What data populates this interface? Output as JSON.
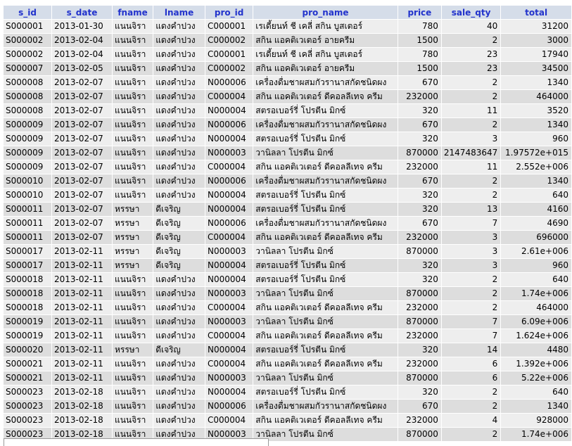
{
  "table": {
    "columns": [
      "s_id",
      "s_date",
      "fname",
      "lname",
      "pro_id",
      "pro_name",
      "price",
      "sale_qty",
      "total"
    ],
    "rows": [
      [
        "S000001",
        "2013-01-30",
        "แนนจิรา",
        "แดงคำปวง",
        "C000001",
        "เรเดี้ยนท์ ชี เคลี่ สกิน บูสเตอร์",
        "780",
        "40",
        "31200"
      ],
      [
        "S000002",
        "2013-02-04",
        "แนนจิรา",
        "แดงคำปวง",
        "C000002",
        "สกิน แอคติเวเตอร์ อายครีม",
        "1500",
        "2",
        "3000"
      ],
      [
        "S000002",
        "2013-02-04",
        "แนนจิรา",
        "แดงคำปวง",
        "C000001",
        "เรเดี้ยนท์ ชี เคลี่ สกิน บูสเตอร์",
        "780",
        "23",
        "17940"
      ],
      [
        "S000007",
        "2013-02-05",
        "แนนจิรา",
        "แดงคำปวง",
        "C000002",
        "สกิน แอคติเวเตอร์ อายครีม",
        "1500",
        "23",
        "34500"
      ],
      [
        "S000008",
        "2013-02-07",
        "แนนจิรา",
        "แดงคำปวง",
        "N000006",
        "เครื่องดื่มชาผสมกัวรานาสกัดชนิดผง",
        "670",
        "2",
        "1340"
      ],
      [
        "S000008",
        "2013-02-07",
        "แนนจิรา",
        "แดงคำปวง",
        "C000004",
        "สกิน แอคติเวเตอร์ ดีคอลลีเทจ ครีม",
        "232000",
        "2",
        "464000"
      ],
      [
        "S000008",
        "2013-02-07",
        "แนนจิรา",
        "แดงคำปวง",
        "N000004",
        "สตรอเบอร์รี่ โปรตีน มิกซ์",
        "320",
        "11",
        "3520"
      ],
      [
        "S000009",
        "2013-02-07",
        "แนนจิรา",
        "แดงคำปวง",
        "N000006",
        "เครื่องดื่มชาผสมกัวรานาสกัดชนิดผง",
        "670",
        "2",
        "1340"
      ],
      [
        "S000009",
        "2013-02-07",
        "แนนจิรา",
        "แดงคำปวง",
        "N000004",
        "สตรอเบอร์รี่ โปรตีน มิกซ์",
        "320",
        "3",
        "960"
      ],
      [
        "S000009",
        "2013-02-07",
        "แนนจิรา",
        "แดงคำปวง",
        "N000003",
        "วานิลลา โปรตีน มิกซ์",
        "870000",
        "2147483647",
        "1.97572e+015"
      ],
      [
        "S000009",
        "2013-02-07",
        "แนนจิรา",
        "แดงคำปวง",
        "C000004",
        "สกิน แอคติเวเตอร์ ดีคอลลีเทจ ครีม",
        "232000",
        "11",
        "2.552e+006"
      ],
      [
        "S000010",
        "2013-02-07",
        "แนนจิรา",
        "แดงคำปวง",
        "N000006",
        "เครื่องดื่มชาผสมกัวรานาสกัดชนิดผง",
        "670",
        "2",
        "1340"
      ],
      [
        "S000010",
        "2013-02-07",
        "แนนจิรา",
        "แดงคำปวง",
        "N000004",
        "สตรอเบอร์รี่ โปรตีน มิกซ์",
        "320",
        "2",
        "640"
      ],
      [
        "S000011",
        "2013-02-07",
        "หรรษา",
        "ดีเจริญ",
        "N000004",
        "สตรอเบอร์รี่ โปรตีน มิกซ์",
        "320",
        "13",
        "4160"
      ],
      [
        "S000011",
        "2013-02-07",
        "หรรษา",
        "ดีเจริญ",
        "N000006",
        "เครื่องดื่มชาผสมกัวรานาสกัดชนิดผง",
        "670",
        "7",
        "4690"
      ],
      [
        "S000011",
        "2013-02-07",
        "หรรษา",
        "ดีเจริญ",
        "C000004",
        "สกิน แอคติเวเตอร์ ดีคอลลีเทจ ครีม",
        "232000",
        "3",
        "696000"
      ],
      [
        "S000017",
        "2013-02-11",
        "หรรษา",
        "ดีเจริญ",
        "N000003",
        "วานิลลา โปรตีน มิกซ์",
        "870000",
        "3",
        "2.61e+006"
      ],
      [
        "S000017",
        "2013-02-11",
        "หรรษา",
        "ดีเจริญ",
        "N000004",
        "สตรอเบอร์รี่ โปรตีน มิกซ์",
        "320",
        "3",
        "960"
      ],
      [
        "S000018",
        "2013-02-11",
        "แนนจิรา",
        "แดงคำปวง",
        "N000004",
        "สตรอเบอร์รี่ โปรตีน มิกซ์",
        "320",
        "2",
        "640"
      ],
      [
        "S000018",
        "2013-02-11",
        "แนนจิรา",
        "แดงคำปวง",
        "N000003",
        "วานิลลา โปรตีน มิกซ์",
        "870000",
        "2",
        "1.74e+006"
      ],
      [
        "S000018",
        "2013-02-11",
        "แนนจิรา",
        "แดงคำปวง",
        "C000004",
        "สกิน แอคติเวเตอร์ ดีคอลลีเทจ ครีม",
        "232000",
        "2",
        "464000"
      ],
      [
        "S000019",
        "2013-02-11",
        "แนนจิรา",
        "แดงคำปวง",
        "N000003",
        "วานิลลา โปรตีน มิกซ์",
        "870000",
        "7",
        "6.09e+006"
      ],
      [
        "S000019",
        "2013-02-11",
        "แนนจิรา",
        "แดงคำปวง",
        "C000004",
        "สกิน แอคติเวเตอร์ ดีคอลลีเทจ ครีม",
        "232000",
        "7",
        "1.624e+006"
      ],
      [
        "S000020",
        "2013-02-11",
        "หรรษา",
        "ดีเจริญ",
        "N000004",
        "สตรอเบอร์รี่ โปรตีน มิกซ์",
        "320",
        "14",
        "4480"
      ],
      [
        "S000021",
        "2013-02-11",
        "แนนจิรา",
        "แดงคำปวง",
        "C000004",
        "สกิน แอคติเวเตอร์ ดีคอลลีเทจ ครีม",
        "232000",
        "6",
        "1.392e+006"
      ],
      [
        "S000021",
        "2013-02-11",
        "แนนจิรา",
        "แดงคำปวง",
        "N000003",
        "วานิลลา โปรตีน มิกซ์",
        "870000",
        "6",
        "5.22e+006"
      ],
      [
        "S000023",
        "2013-02-18",
        "แนนจิรา",
        "แดงคำปวง",
        "N000004",
        "สตรอเบอร์รี่ โปรตีน มิกซ์",
        "320",
        "2",
        "640"
      ],
      [
        "S000023",
        "2013-02-18",
        "แนนจิรา",
        "แดงคำปวง",
        "N000006",
        "เครื่องดื่มชาผสมกัวรานาสกัดชนิดผง",
        "670",
        "2",
        "1340"
      ],
      [
        "S000023",
        "2013-02-18",
        "แนนจิรา",
        "แดงคำปวง",
        "C000004",
        "สกิน แอคติเวเตอร์ ดีคอลลีเทจ ครีม",
        "232000",
        "4",
        "928000"
      ],
      [
        "S000023",
        "2013-02-18",
        "แนนจิรา",
        "แดงคำปวง",
        "N000003",
        "วานิลลา โปรตีน มิกซ์",
        "870000",
        "2",
        "1.74e+006"
      ]
    ]
  },
  "colors": {
    "header_bg": "#d5dde9",
    "header_text": "#2233cc",
    "row_odd": "#eeeeee",
    "row_even": "#dddddd"
  }
}
